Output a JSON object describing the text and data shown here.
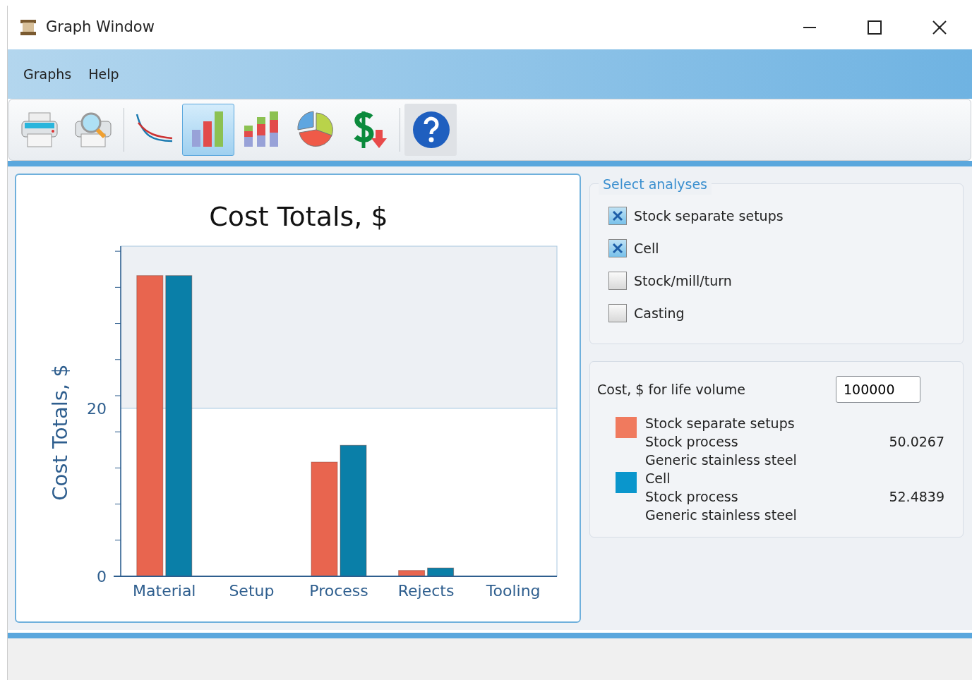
{
  "window": {
    "title": "Graph Window"
  },
  "menu": [
    {
      "label": "Graphs"
    },
    {
      "label": "Help"
    }
  ],
  "toolbar": [
    {
      "kind": "print",
      "selected": false
    },
    {
      "kind": "preview",
      "selected": false
    },
    {
      "kind": "sep"
    },
    {
      "kind": "line",
      "selected": false
    },
    {
      "kind": "bar",
      "selected": true
    },
    {
      "kind": "stacked",
      "selected": false
    },
    {
      "kind": "pie",
      "selected": false
    },
    {
      "kind": "dollar",
      "selected": false
    },
    {
      "kind": "sep"
    },
    {
      "kind": "help",
      "selected": false
    }
  ],
  "chart": {
    "chart_data": {
      "type": "bar",
      "title": "Cost Totals, $",
      "ylabel": "Cost Totals, $",
      "categories": [
        "Material",
        "Setup",
        "Process",
        "Rejects",
        "Tooling"
      ],
      "series": [
        {
          "color": "#e8654f",
          "values": [
            35.8,
            0,
            13.6,
            0.7,
            0
          ]
        },
        {
          "color": "#0a7fa8",
          "values": [
            35.8,
            0,
            15.6,
            1.0,
            0
          ]
        }
      ],
      "ylim": [
        0,
        39.3
      ],
      "yticks": [
        0,
        20
      ],
      "ref_lines": [
        {
          "axis": "y",
          "value": 20
        }
      ]
    }
  },
  "analyses": {
    "title": "Select analyses",
    "items": [
      {
        "label": "Stock separate setups",
        "checked": true
      },
      {
        "label": "Cell",
        "checked": true
      },
      {
        "label": "Stock/mill/turn",
        "checked": false
      },
      {
        "label": "Casting",
        "checked": false
      }
    ]
  },
  "costs": {
    "label": "Cost, $ for life volume",
    "volume": "100000",
    "legend": [
      {
        "color": "#f07a5e",
        "lines": [
          "Stock separate setups",
          "Stock process",
          "Generic stainless steel"
        ],
        "value": "50.0267"
      },
      {
        "color": "#0a96cc",
        "lines": [
          "Cell",
          "Stock process",
          "Generic stainless steel"
        ],
        "value": "52.4839"
      }
    ]
  }
}
